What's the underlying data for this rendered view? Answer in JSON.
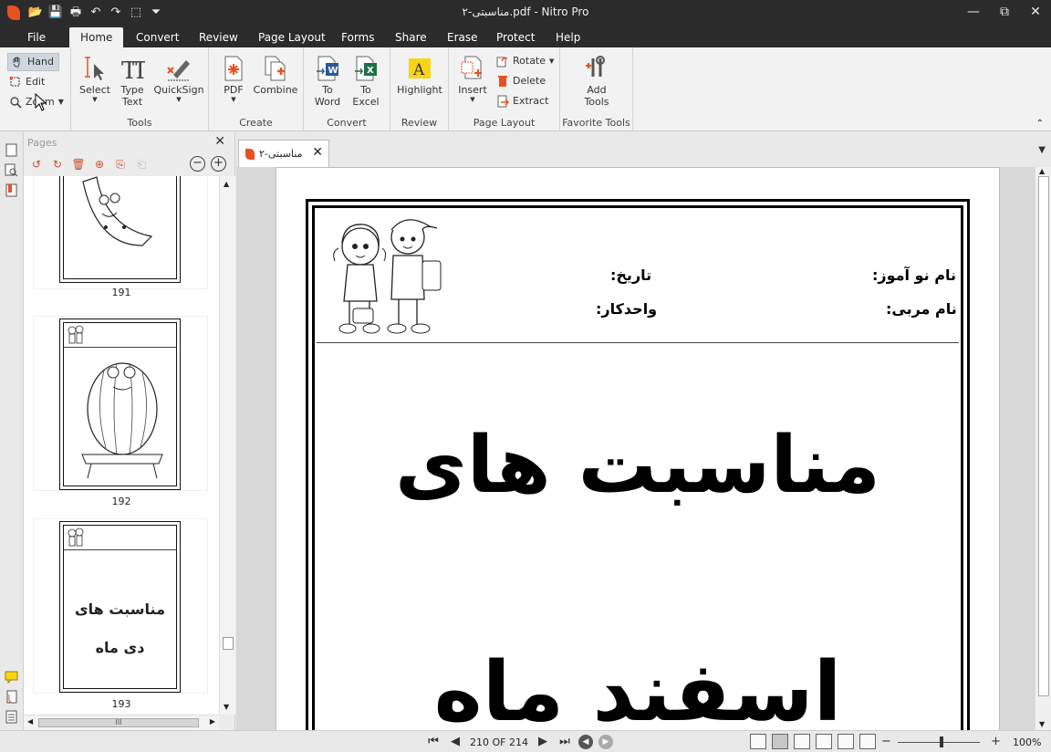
{
  "window": {
    "title": "مناسبتی-۲.pdf - Nitro Pro",
    "minimize": "—",
    "restore": "⧉",
    "close": "✕"
  },
  "quick_access": {
    "open": "📂",
    "save": "💾",
    "print": "🖶",
    "undo": "↶",
    "redo": "↷",
    "select_tool": "⬚",
    "customize": "⏷"
  },
  "menu_tabs": {
    "file": "File",
    "home": "Home",
    "convert": "Convert",
    "review": "Review",
    "page_layout": "Page Layout",
    "forms": "Forms",
    "share": "Share",
    "erase": "Erase",
    "protect": "Protect",
    "help": "Help"
  },
  "ribbon": {
    "view_group": {
      "hand": "Hand",
      "edit": "Edit",
      "zoom": "Zoom"
    },
    "tools_group": {
      "label": "Tools",
      "select": "Select",
      "type_text_1": "Type",
      "type_text_2": "Text",
      "quicksign": "QuickSign"
    },
    "create_group": {
      "label": "Create",
      "pdf": "PDF",
      "combine": "Combine"
    },
    "convert_group": {
      "label": "Convert",
      "to_word_1": "To",
      "to_word_2": "Word",
      "to_excel_1": "To",
      "to_excel_2": "Excel"
    },
    "review_group": {
      "label": "Review",
      "highlight": "Highlight"
    },
    "page_layout_group": {
      "label": "Page Layout",
      "insert": "Insert",
      "rotate": "Rotate",
      "delete": "Delete",
      "extract": "Extract"
    },
    "favorite_group": {
      "label": "Favorite Tools",
      "add_tools_1": "Add",
      "add_tools_2": "Tools"
    }
  },
  "pages_panel": {
    "header": "Pages",
    "close": "✕",
    "zoom_out": "−",
    "zoom_in": "+",
    "thumbnails": [
      {
        "number": "191",
        "content": ""
      },
      {
        "number": "192",
        "content": ""
      },
      {
        "number": "193",
        "line1": "مناسبت های",
        "line2": "دی ماه"
      }
    ],
    "scroll_grip": "III"
  },
  "document": {
    "tab_title": "مناسبتی-۲",
    "tab_close": "✕",
    "fields": {
      "student_name": "نام نو آموز:",
      "date": "تاریخ:",
      "teacher_name": "نام مربی:",
      "unit": "واحدکار:"
    },
    "heading_line1": "مناسبت های",
    "heading_line2": "اسفند ماه"
  },
  "status_bar": {
    "page_display": "210 OF 214",
    "zoom_level": "100%",
    "zoom_minus": "−",
    "zoom_plus": "+"
  },
  "colors": {
    "titlebar": "#2b2b2b",
    "ribbon": "#f2f2f2",
    "brand": "#e8501f",
    "word_blue": "#2b5797",
    "excel_green": "#1e7145",
    "highlight_yellow": "#f7d417"
  }
}
